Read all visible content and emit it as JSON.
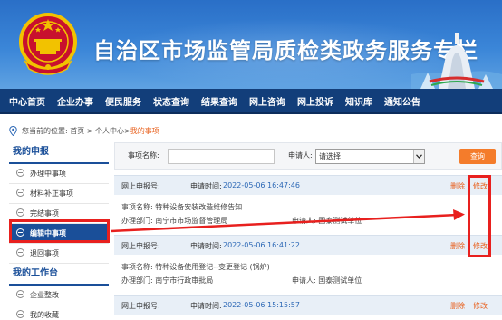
{
  "banner": {
    "title": "自治区市场监管局质检类政务服务专栏",
    "emblem_icon": "national-emblem-icon",
    "skyline_icon": "city-skyline-icon"
  },
  "nav": {
    "items": [
      "中心首页",
      "企业办事",
      "便民服务",
      "状态查询",
      "结果查询",
      "网上咨询",
      "网上投诉",
      "知识库",
      "通知公告"
    ]
  },
  "breadcrumb": {
    "prefix": "您当前的位置: 首页 > 个人中心> ",
    "current": "我的事项"
  },
  "sidebar": {
    "section1_title": "我的申报",
    "section1_items": [
      "办理中事项",
      "材料补正事项",
      "完结事项",
      "编辑中事项",
      "退回事项"
    ],
    "active_index": 3,
    "section2_title": "我的工作台",
    "section2_items": [
      "企业整改",
      "我的收藏"
    ]
  },
  "filter": {
    "name_label": "事项名称:",
    "name_value": "",
    "applicant_label": "申请人:",
    "applicant_selected": "请选择",
    "query_button": "查询"
  },
  "records": [
    {
      "type": "网上申报号:",
      "time_label": "申请时间:",
      "time": "2022-05-06 16:47:46",
      "delete": "删除",
      "edit": "修改",
      "item_name": "事项名称: 特种设备安装改造维修告知",
      "dept": "办理部门: 南宁市市场监督管理局",
      "applicant": "申请人: 国泰测试单位"
    },
    {
      "type": "网上申报号:",
      "time_label": "申请时间:",
      "time": "2022-05-06 16:41:22",
      "delete": "删除",
      "edit": "修改",
      "item_name": "事项名称: 特种设备使用登记--变更登记 (锅炉)",
      "dept": "办理部门: 南宁市行政审批局",
      "applicant": "申请人: 国泰测试单位"
    },
    {
      "type": "网上申报号:",
      "time_label": "申请时间:",
      "time": "2022-05-06 15:15:57",
      "delete": "删除",
      "edit": "修改"
    }
  ],
  "colors": {
    "nav_bg": "#123e7a",
    "accent_orange": "#f47c2b",
    "highlight_red": "#e8201e",
    "time_blue": "#2e69b6"
  }
}
